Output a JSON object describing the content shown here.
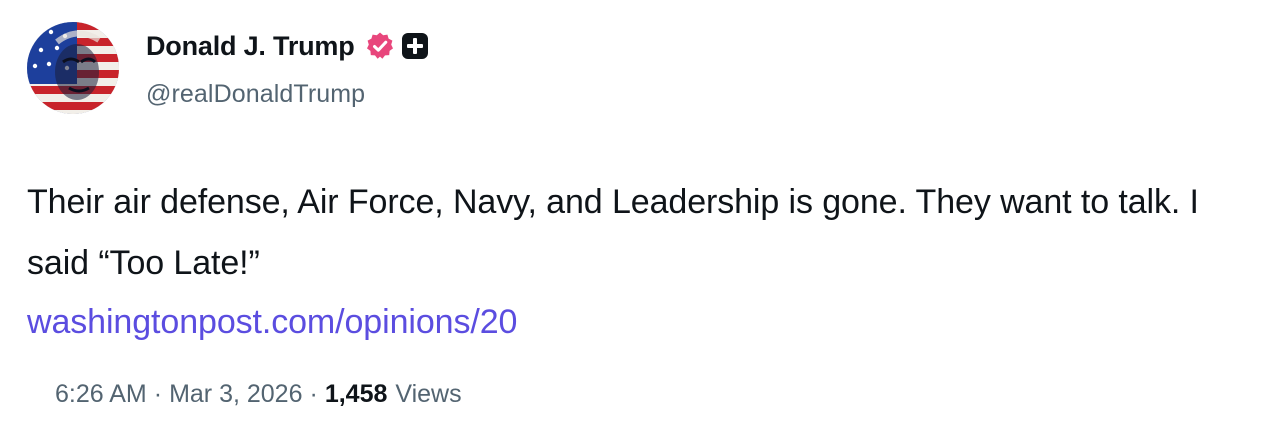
{
  "post": {
    "author": {
      "display_name": "Donald J. Trump",
      "handle": "@realDonaldTrump",
      "verified_icon": "verified-badge-icon",
      "plus_icon": "plus-badge-icon"
    },
    "text": "Their air defense, Air Force, Navy, and Leadership is gone. They want to talk. I said “Too Late!”",
    "link": "washingtonpost.com/opinions/20",
    "meta": {
      "time": "6:26 AM",
      "separator": "·",
      "date": "Mar 3, 2026",
      "views_count": "1,458",
      "views_label": "Views"
    }
  },
  "colors": {
    "text": "#0f1419",
    "secondary": "#536471",
    "link": "#5b4de0",
    "verified_badge": "#e8467c"
  }
}
